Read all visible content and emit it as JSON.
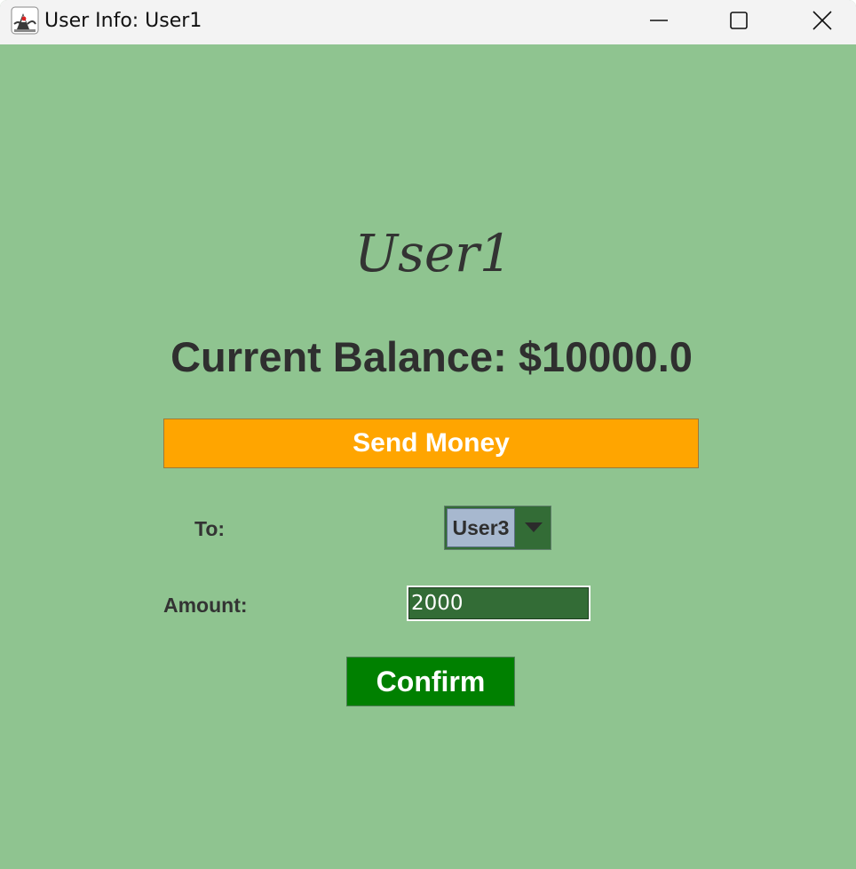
{
  "window": {
    "title": "User Info: User1",
    "icon": "java-duke-icon",
    "controls": [
      "minimize-icon",
      "maximize-icon",
      "close-icon"
    ]
  },
  "main": {
    "username": "User1",
    "balance_text": "Current Balance: $10000.0",
    "send_money_label": "Send Money",
    "to_label": "To:",
    "recipient_selected": "User3",
    "amount_label": "Amount:",
    "amount_value": "2000",
    "confirm_label": "Confirm"
  },
  "colors": {
    "background": "#8fc490",
    "send_button": "#ffa500",
    "confirm_button": "#008000",
    "field_bg": "#336c36",
    "combo_value_bg": "#a7b8cf",
    "text_dark": "#333333"
  }
}
